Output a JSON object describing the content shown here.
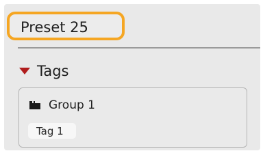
{
  "preset": {
    "title": "Preset 25",
    "highlight_color": "#f5a623"
  },
  "tags_section": {
    "label": "Tags",
    "expanded": true,
    "toggle_icon": "triangle-down-icon",
    "toggle_color": "#b01d1d",
    "groups": [
      {
        "label": "Group 1",
        "icon": "folder-icon",
        "tags": [
          "Tag 1"
        ]
      }
    ]
  }
}
